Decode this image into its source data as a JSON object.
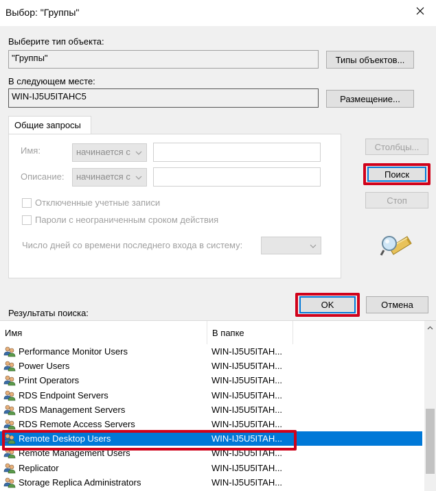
{
  "window": {
    "title": "Выбор: \"Группы\""
  },
  "object_type": {
    "label": "Выберите тип объекта:",
    "value": "\"Группы\"",
    "button": "Типы объектов..."
  },
  "location": {
    "label": "В следующем месте:",
    "value": "WIN-IJ5U5ITAHC5",
    "button": "Размещение..."
  },
  "tab": {
    "label": "Общие запросы",
    "name_label": "Имя:",
    "name_combo": "начинается с",
    "desc_label": "Описание:",
    "desc_combo": "начинается с",
    "disabled_accounts": "Отключенные учетные записи",
    "no_expire_passwords": "Пароли с неограниченным сроком действия",
    "days_label": "Число дней со времени последнего входа в систему:"
  },
  "side_buttons": {
    "columns": "Столбцы...",
    "search": "Поиск",
    "stop": "Стоп"
  },
  "dialog_buttons": {
    "ok": "OK",
    "cancel": "Отмена"
  },
  "results": {
    "label": "Результаты поиска:",
    "columns": [
      "Имя",
      "В папке"
    ],
    "rows": [
      {
        "name": "Performance Monitor Users",
        "folder": "WIN-IJ5U5ITAH..."
      },
      {
        "name": "Power Users",
        "folder": "WIN-IJ5U5ITAH..."
      },
      {
        "name": "Print Operators",
        "folder": "WIN-IJ5U5ITAH..."
      },
      {
        "name": "RDS Endpoint Servers",
        "folder": "WIN-IJ5U5ITAH..."
      },
      {
        "name": "RDS Management Servers",
        "folder": "WIN-IJ5U5ITAH..."
      },
      {
        "name": "RDS Remote Access Servers",
        "folder": "WIN-IJ5U5ITAH..."
      },
      {
        "name": "Remote Desktop Users",
        "folder": "WIN-IJ5U5ITAH...",
        "selected": true
      },
      {
        "name": "Remote Management Users",
        "folder": "WIN-IJ5U5ITAH..."
      },
      {
        "name": "Replicator",
        "folder": "WIN-IJ5U5ITAH..."
      },
      {
        "name": "Storage Replica Administrators",
        "folder": "WIN-IJ5U5ITAH..."
      }
    ]
  },
  "colors": {
    "highlight": "#d0021b",
    "selection": "#0078d7"
  },
  "icons": [
    "close-icon",
    "search-flashlight-icon",
    "group-icon",
    "chevron-down-icon"
  ]
}
